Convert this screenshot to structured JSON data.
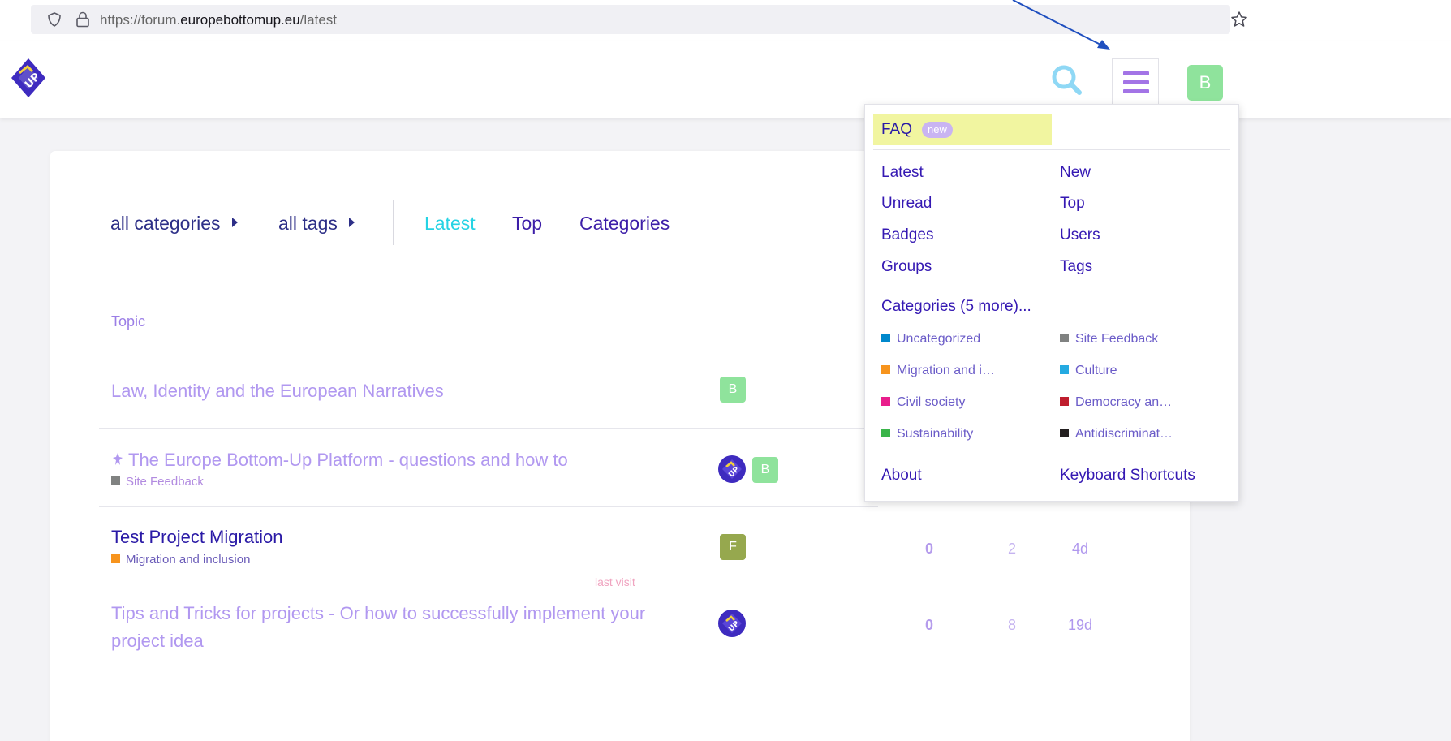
{
  "browser": {
    "url_prefix": "https://forum.",
    "url_domain": "europebottomup.eu",
    "url_path": "/latest"
  },
  "header": {
    "user_initial": "B",
    "colors": {
      "search": "#8fd8f5",
      "menu": "#a374e6",
      "avatar": "#8fe39c"
    }
  },
  "nav": {
    "all_categories": "all categories",
    "all_tags": "all tags",
    "tabs": [
      "Latest",
      "Top",
      "Categories"
    ]
  },
  "topic_list": {
    "header_topic": "Topic",
    "last_visit": "last visit",
    "topics": [
      {
        "title": "Law, Identity and the European Narratives",
        "category": "",
        "posters": [
          "B"
        ]
      },
      {
        "pinned_icon": "pin-icon",
        "title": "The Europe Bottom-Up Platform - questions and how to",
        "category": "Site Feedback",
        "posters": [
          "logo",
          "B"
        ]
      },
      {
        "title": "Test Project Migration",
        "category": "Migration and inclusion",
        "posters": [
          "F"
        ],
        "replies": "0",
        "views": "2",
        "activity": "4d"
      },
      {
        "title_line1": "Tips and Tricks for projects - Or how to successfully implement your",
        "title_line2": "project idea",
        "posters": [
          "logo"
        ],
        "replies": "0",
        "views": "8",
        "activity": "19d"
      }
    ]
  },
  "menu": {
    "faq": "FAQ",
    "faq_badge": "new",
    "links_left": [
      "Latest",
      "Unread",
      "Badges",
      "Groups"
    ],
    "links_right": [
      "New",
      "Top",
      "Users",
      "Tags"
    ],
    "categories_header": "Categories (5 more)...",
    "categories_left": [
      {
        "name": "Uncategorized",
        "color": "#0088cc"
      },
      {
        "name": "Migration and i…",
        "color": "#f7941d"
      },
      {
        "name": "Civil society",
        "color": "#e91e8c"
      },
      {
        "name": "Sustainability",
        "color": "#3ab54a"
      }
    ],
    "categories_right": [
      {
        "name": "Site Feedback",
        "color": "#808281"
      },
      {
        "name": "Culture",
        "color": "#25aae1"
      },
      {
        "name": "Democracy an…",
        "color": "#bf1e2e"
      },
      {
        "name": "Antidiscriminat…",
        "color": "#231f20"
      }
    ],
    "about": "About",
    "keyboard_shortcuts": "Keyboard Shortcuts"
  }
}
